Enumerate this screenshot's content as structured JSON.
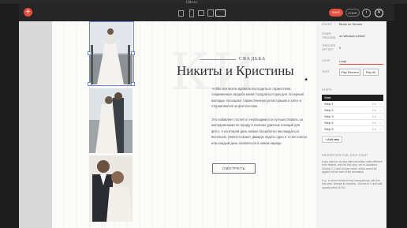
{
  "browser": {
    "url": "tilda.cc"
  },
  "toolbar": {
    "add_label": "+",
    "save_label": "SAVE",
    "code_label": "CODE",
    "info_label": "i",
    "close_label": "✕",
    "more_label": "⋯"
  },
  "hero": {
    "ghost": "КИ",
    "kicker": "СВАДЬБА",
    "title": "Никиты и Кристины",
    "paragraph1": "Чтобы все могли вдоволь насладиться торжеством, современная свадьба может продлиться два дня. В первый молодые посещают торжественную регистрацию в загсе и отправляются на фотосессию.",
    "paragraph2": "Это избавляет гостей от необходимости путешествовать за молодоженами по городу в поисках удачных локаций для фото. А на второй день можно беззаботно наслаждаться весельем. Невеста может дважды надеть одно и то же платье или каждый день появляться в новом наряде.",
    "cta": "СМОТРЕТЬ"
  },
  "panel": {
    "event_label": "EVENT",
    "event_value": "Block on Screen",
    "trigger_label": "START TRIGGER",
    "trigger_value": "on Window Center",
    "offset_label": "TRIGGER OFFSET",
    "offset_value": "0",
    "loop_label": "LOOP",
    "loop_value": "Loop",
    "test_label": "TEST",
    "play_element": "Play Element",
    "play_all": "Play All",
    "steps_label": "STEPS",
    "steps_head": "Start",
    "steps": [
      {
        "label": "Step 1",
        "time": "0 s"
      },
      {
        "label": "Step 2",
        "time": "0 s"
      },
      {
        "label": "Step 3",
        "time": "0 s"
      },
      {
        "label": "Step 4",
        "time": "0 s"
      },
      {
        "label": "Step 5",
        "time": "0 s"
      }
    ],
    "add_step": "+ Add step",
    "props_label": "PROPERTIES FOR: STEP START",
    "hint1": "If you want to set any start animation state different from default, add the first step, set to durations. Volume 0.1 and choose value, which would be applied at the start of the animation.",
    "hint2": "E.g.: to show element from transparency, add the first step, change its duration. Volume to 0 and add opacity value to 0%."
  },
  "colors": {
    "accent": "#e5503e",
    "selection": "#6a86d8",
    "panel_bg": "#f4f4f4",
    "canvas_bg": "#fbfbfa"
  }
}
